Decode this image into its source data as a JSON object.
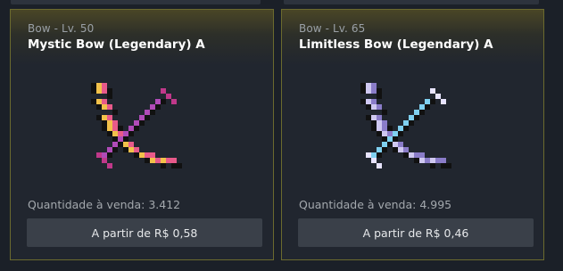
{
  "listings": [
    {
      "category": "Bow - Lv. 50",
      "name": "Mystic Bow (Legendary) A",
      "icon": "mystic-bow-icon",
      "quantity_text": "Quantidade à venda: 3.412",
      "buy_label": "A partir de R$ 0,58"
    },
    {
      "category": "Bow - Lv. 65",
      "name": "Limitless Bow (Legendary) A",
      "icon": "limitless-bow-icon",
      "quantity_text": "Quantidade à venda: 4.995",
      "buy_label": "A partir de R$ 0,46"
    }
  ],
  "colors": {
    "card_border": "#6b6a2e",
    "card_bg": "#21262f",
    "button_bg": "#3a4049",
    "page_bg": "#1b2028"
  }
}
